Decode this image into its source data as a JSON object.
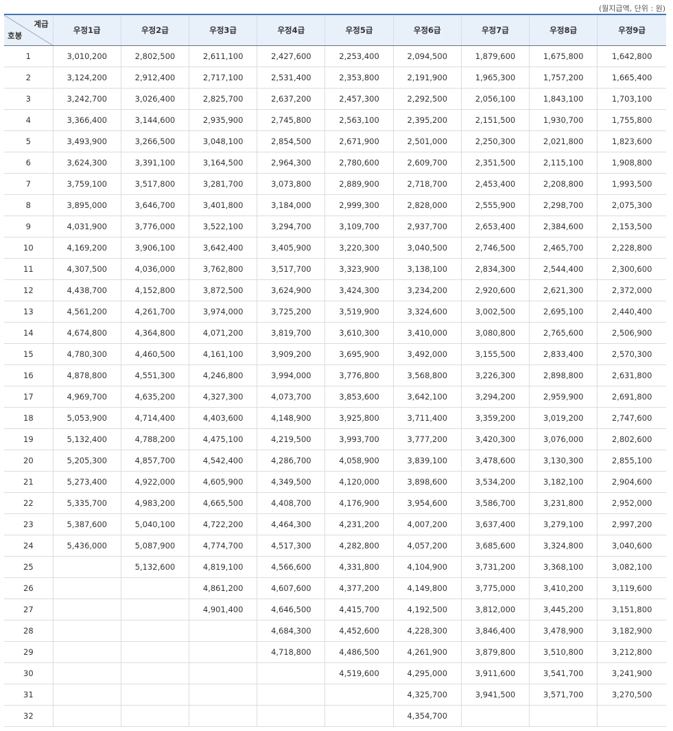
{
  "caption": "(월지급액, 단위 : 원)",
  "header": {
    "corner_grade": "계급",
    "corner_step": "호봉",
    "grades": [
      "우정1급",
      "우정2급",
      "우정3급",
      "우정4급",
      "우정5급",
      "우정6급",
      "우정7급",
      "우정8급",
      "우정9급"
    ]
  },
  "rows": [
    [
      "1",
      "3,010,200",
      "2,802,500",
      "2,611,100",
      "2,427,600",
      "2,253,400",
      "2,094,500",
      "1,879,600",
      "1,675,800",
      "1,642,800"
    ],
    [
      "2",
      "3,124,200",
      "2,912,400",
      "2,717,100",
      "2,531,400",
      "2,353,800",
      "2,191,900",
      "1,965,300",
      "1,757,200",
      "1,665,400"
    ],
    [
      "3",
      "3,242,700",
      "3,026,400",
      "2,825,700",
      "2,637,200",
      "2,457,300",
      "2,292,500",
      "2,056,100",
      "1,843,100",
      "1,703,100"
    ],
    [
      "4",
      "3,366,400",
      "3,144,600",
      "2,935,900",
      "2,745,800",
      "2,563,100",
      "2,395,200",
      "2,151,500",
      "1,930,700",
      "1,755,800"
    ],
    [
      "5",
      "3,493,900",
      "3,266,500",
      "3,048,100",
      "2,854,500",
      "2,671,900",
      "2,501,000",
      "2,250,300",
      "2,021,800",
      "1,823,600"
    ],
    [
      "6",
      "3,624,300",
      "3,391,100",
      "3,164,500",
      "2,964,300",
      "2,780,600",
      "2,609,700",
      "2,351,500",
      "2,115,100",
      "1,908,800"
    ],
    [
      "7",
      "3,759,100",
      "3,517,800",
      "3,281,700",
      "3,073,800",
      "2,889,900",
      "2,718,700",
      "2,453,400",
      "2,208,800",
      "1,993,500"
    ],
    [
      "8",
      "3,895,000",
      "3,646,700",
      "3,401,800",
      "3,184,000",
      "2,999,300",
      "2,828,000",
      "2,555,900",
      "2,298,700",
      "2,075,300"
    ],
    [
      "9",
      "4,031,900",
      "3,776,000",
      "3,522,100",
      "3,294,700",
      "3,109,700",
      "2,937,700",
      "2,653,400",
      "2,384,600",
      "2,153,500"
    ],
    [
      "10",
      "4,169,200",
      "3,906,100",
      "3,642,400",
      "3,405,900",
      "3,220,300",
      "3,040,500",
      "2,746,500",
      "2,465,700",
      "2,228,800"
    ],
    [
      "11",
      "4,307,500",
      "4,036,000",
      "3,762,800",
      "3,517,700",
      "3,323,900",
      "3,138,100",
      "2,834,300",
      "2,544,400",
      "2,300,600"
    ],
    [
      "12",
      "4,438,700",
      "4,152,800",
      "3,872,500",
      "3,624,900",
      "3,424,300",
      "3,234,200",
      "2,920,600",
      "2,621,300",
      "2,372,000"
    ],
    [
      "13",
      "4,561,200",
      "4,261,700",
      "3,974,000",
      "3,725,200",
      "3,519,900",
      "3,324,600",
      "3,002,500",
      "2,695,100",
      "2,440,400"
    ],
    [
      "14",
      "4,674,800",
      "4,364,800",
      "4,071,200",
      "3,819,700",
      "3,610,300",
      "3,410,000",
      "3,080,800",
      "2,765,600",
      "2,506,900"
    ],
    [
      "15",
      "4,780,300",
      "4,460,500",
      "4,161,100",
      "3,909,200",
      "3,695,900",
      "3,492,000",
      "3,155,500",
      "2,833,400",
      "2,570,300"
    ],
    [
      "16",
      "4,878,800",
      "4,551,300",
      "4,246,800",
      "3,994,000",
      "3,776,800",
      "3,568,800",
      "3,226,300",
      "2,898,800",
      "2,631,800"
    ],
    [
      "17",
      "4,969,700",
      "4,635,200",
      "4,327,300",
      "4,073,700",
      "3,853,600",
      "3,642,100",
      "3,294,200",
      "2,959,900",
      "2,691,800"
    ],
    [
      "18",
      "5,053,900",
      "4,714,400",
      "4,403,600",
      "4,148,900",
      "3,925,800",
      "3,711,400",
      "3,359,200",
      "3,019,200",
      "2,747,600"
    ],
    [
      "19",
      "5,132,400",
      "4,788,200",
      "4,475,100",
      "4,219,500",
      "3,993,700",
      "3,777,200",
      "3,420,300",
      "3,076,000",
      "2,802,600"
    ],
    [
      "20",
      "5,205,300",
      "4,857,700",
      "4,542,400",
      "4,286,700",
      "4,058,900",
      "3,839,100",
      "3,478,600",
      "3,130,300",
      "2,855,100"
    ],
    [
      "21",
      "5,273,400",
      "4,922,000",
      "4,605,900",
      "4,349,500",
      "4,120,000",
      "3,898,600",
      "3,534,200",
      "3,182,100",
      "2,904,600"
    ],
    [
      "22",
      "5,335,700",
      "4,983,200",
      "4,665,500",
      "4,408,700",
      "4,176,900",
      "3,954,600",
      "3,586,700",
      "3,231,800",
      "2,952,000"
    ],
    [
      "23",
      "5,387,600",
      "5,040,100",
      "4,722,200",
      "4,464,300",
      "4,231,200",
      "4,007,200",
      "3,637,400",
      "3,279,100",
      "2,997,200"
    ],
    [
      "24",
      "5,436,000",
      "5,087,900",
      "4,774,700",
      "4,517,300",
      "4,282,800",
      "4,057,200",
      "3,685,600",
      "3,324,800",
      "3,040,600"
    ],
    [
      "25",
      "",
      "5,132,600",
      "4,819,100",
      "4,566,600",
      "4,331,800",
      "4,104,900",
      "3,731,200",
      "3,368,100",
      "3,082,100"
    ],
    [
      "26",
      "",
      "",
      "4,861,200",
      "4,607,600",
      "4,377,200",
      "4,149,800",
      "3,775,000",
      "3,410,200",
      "3,119,600"
    ],
    [
      "27",
      "",
      "",
      "4,901,400",
      "4,646,500",
      "4,415,700",
      "4,192,500",
      "3,812,000",
      "3,445,200",
      "3,151,800"
    ],
    [
      "28",
      "",
      "",
      "",
      "4,684,300",
      "4,452,600",
      "4,228,300",
      "3,846,400",
      "3,478,900",
      "3,182,900"
    ],
    [
      "29",
      "",
      "",
      "",
      "4,718,800",
      "4,486,500",
      "4,261,900",
      "3,879,800",
      "3,510,800",
      "3,212,800"
    ],
    [
      "30",
      "",
      "",
      "",
      "",
      "4,519,600",
      "4,295,000",
      "3,911,600",
      "3,541,700",
      "3,241,900"
    ],
    [
      "31",
      "",
      "",
      "",
      "",
      "",
      "4,325,700",
      "3,941,500",
      "3,571,700",
      "3,270,500"
    ],
    [
      "32",
      "",
      "",
      "",
      "",
      "",
      "4,354,700",
      "",
      "",
      ""
    ]
  ]
}
